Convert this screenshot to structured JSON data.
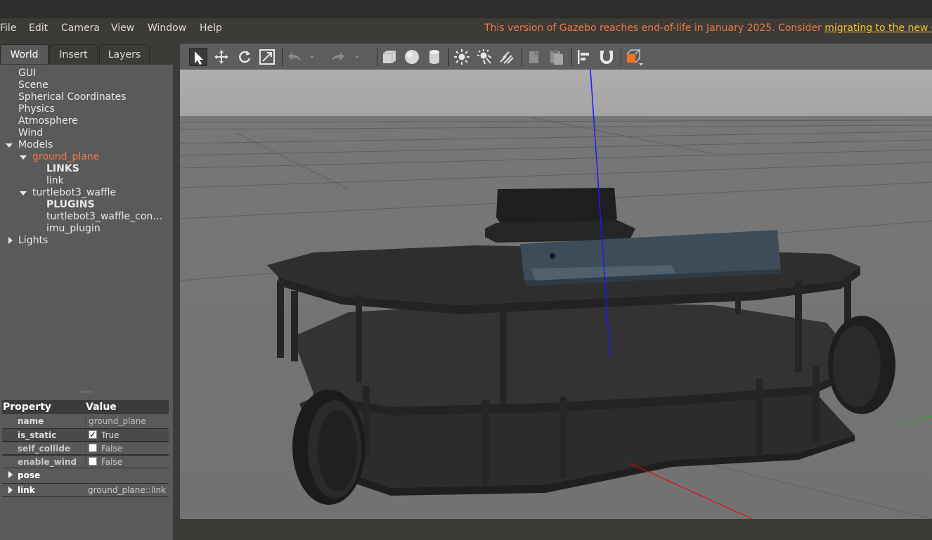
{
  "menu": {
    "items": [
      "File",
      "Edit",
      "Camera",
      "View",
      "Window",
      "Help"
    ]
  },
  "eol_notice": {
    "text": "This version of Gazebo reaches end-of-life in January 2025. Consider ",
    "link": "migrating to the new Gaze"
  },
  "left_panel": {
    "tabs": [
      "World",
      "Insert",
      "Layers"
    ],
    "active_tab": "World",
    "tree": {
      "gui": "GUI",
      "scene": "Scene",
      "spherical": "Spherical Coordinates",
      "physics": "Physics",
      "atmosphere": "Atmosphere",
      "wind": "Wind",
      "models": "Models",
      "ground_plane": "ground_plane",
      "links_header": "LINKS",
      "link": "link",
      "turtlebot": "turtlebot3_waffle",
      "plugins_header": "PLUGINS",
      "plugin_controller": "turtlebot3_waffle_con…",
      "plugin_imu": "imu_plugin",
      "lights": "Lights"
    }
  },
  "properties": {
    "header_property": "Property",
    "header_value": "Value",
    "rows": {
      "name_label": "name",
      "name_value": "ground_plane",
      "is_static_label": "is_static",
      "is_static_value": "True",
      "self_collide_label": "self_collide",
      "self_collide_value": "False",
      "enable_wind_label": "enable_wind",
      "enable_wind_value": "False",
      "pose_label": "pose",
      "link_label": "link",
      "link_value": "ground_plane::link"
    }
  },
  "toolbar": {
    "icons": [
      "select-mode-icon",
      "translate-icon",
      "rotate-icon",
      "scale-icon",
      "undo-icon",
      "redo-icon",
      "box-icon",
      "sphere-icon",
      "cylinder-icon",
      "point-light-icon",
      "spot-light-icon",
      "directional-light-icon",
      "copy-icon",
      "paste-icon",
      "align-icon",
      "snap-icon",
      "view-angle-icon"
    ]
  },
  "colors": {
    "accent_orange": "#f07746",
    "link_yellow": "#f6c12d",
    "panel_bg": "#5a5a5a",
    "viewport_sky": "#a9a9a9"
  }
}
